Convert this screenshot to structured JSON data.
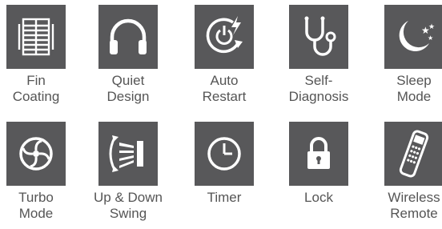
{
  "colors": {
    "tile": "#58585a",
    "icon": "#ffffff",
    "text": "#555555",
    "background": "#ffffff"
  },
  "features": [
    {
      "icon": "fin-coating-icon",
      "line1": "Fin",
      "line2": "Coating"
    },
    {
      "icon": "headphones-icon",
      "line1": "Quiet",
      "line2": "Design"
    },
    {
      "icon": "auto-restart-icon",
      "line1": "Auto",
      "line2": "Restart"
    },
    {
      "icon": "stethoscope-icon",
      "line1": "Self-",
      "line2": "Diagnosis"
    },
    {
      "icon": "moon-stars-icon",
      "line1": "Sleep",
      "line2": "Mode"
    },
    {
      "icon": "turbo-fan-icon",
      "line1": "Turbo",
      "line2": "Mode"
    },
    {
      "icon": "louver-swing-icon",
      "line1": "Up & Down",
      "line2": "Swing"
    },
    {
      "icon": "clock-icon",
      "line1": "Timer",
      "line2": ""
    },
    {
      "icon": "padlock-icon",
      "line1": "Lock",
      "line2": ""
    },
    {
      "icon": "remote-control-icon",
      "line1": "Wireless",
      "line2": "Remote"
    }
  ]
}
